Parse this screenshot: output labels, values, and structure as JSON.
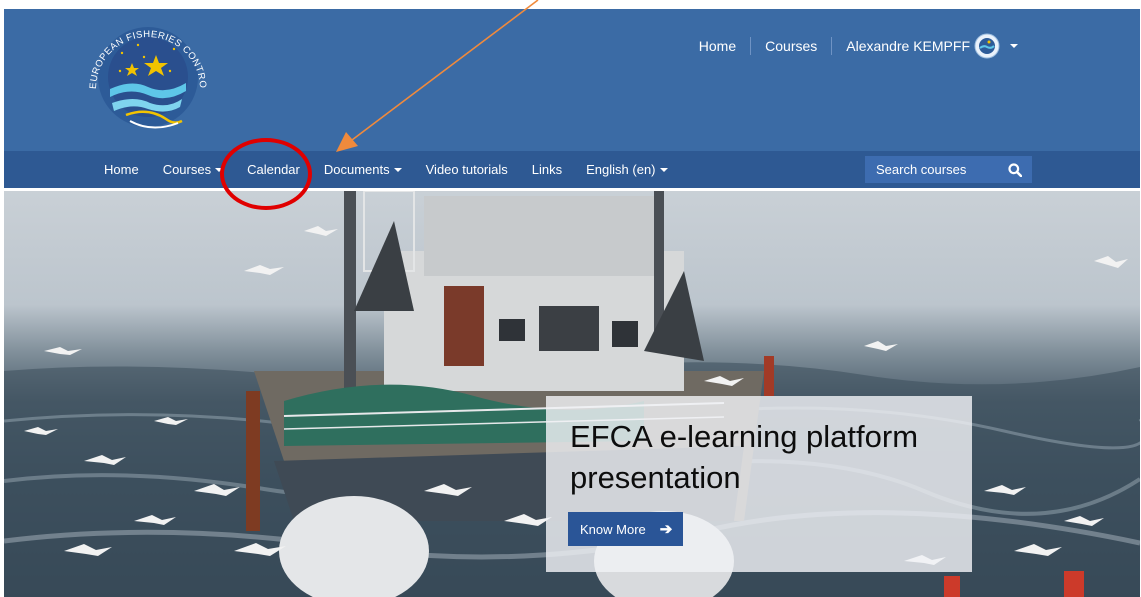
{
  "header": {
    "logo_text": "EUROPEAN FISHERIES CONTROL AGENCY",
    "top_links": [
      "Home",
      "Courses"
    ],
    "user_name": "Alexandre KEMPFF"
  },
  "nav": {
    "items": [
      {
        "label": "Home",
        "dropdown": false
      },
      {
        "label": "Courses",
        "dropdown": true
      },
      {
        "label": "Calendar",
        "dropdown": false
      },
      {
        "label": "Documents",
        "dropdown": true
      },
      {
        "label": "Video tutorials",
        "dropdown": false
      },
      {
        "label": "Links",
        "dropdown": false
      },
      {
        "label": "English (en)",
        "dropdown": true
      }
    ],
    "search_placeholder": "Search courses"
  },
  "hero": {
    "title": "EFCA e-learning platform presentation",
    "button_label": "Know More"
  },
  "colors": {
    "header_bg": "#3b6ba5",
    "nav_bg": "#2e5993",
    "search_bg": "#3d6cb0",
    "button_bg": "#2a5597",
    "annotation_circle": "#e00000",
    "annotation_arrow": "#f08a3c"
  }
}
